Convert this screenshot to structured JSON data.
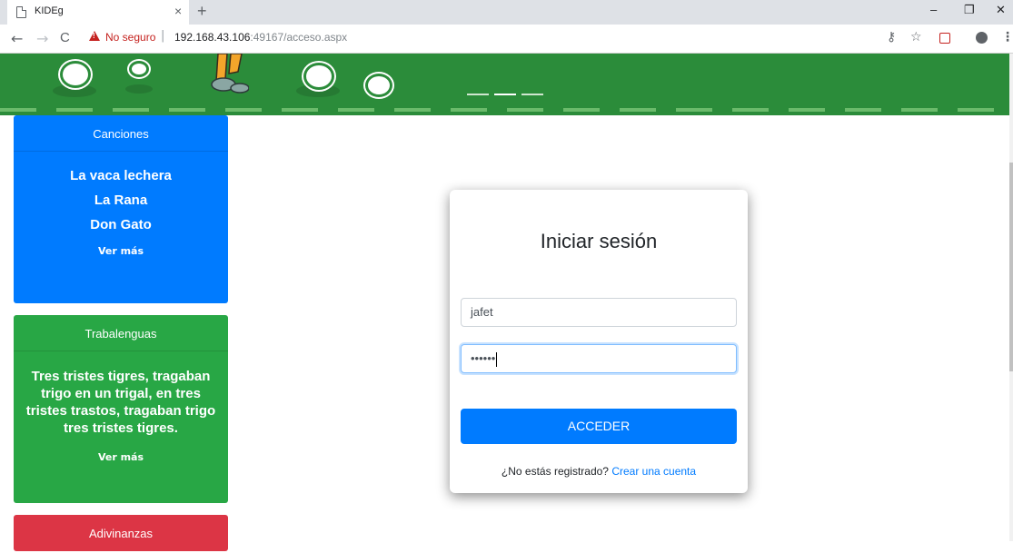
{
  "browser": {
    "tab_title": "KIDEg",
    "tab_close": "×",
    "new_tab": "+",
    "window_controls": {
      "minimize": "–",
      "restore": "❐",
      "close": "✕"
    },
    "nav": {
      "back": "←",
      "forward": "→",
      "reload": "C"
    },
    "url": {
      "security_label": "No seguro",
      "host": "192.168.43.106",
      "path": ":49167/acceso.aspx"
    },
    "toolbar_icons": [
      "key-icon",
      "star-icon",
      "extension-icon",
      "account-icon",
      "menu-icon"
    ]
  },
  "sidebar": {
    "canciones": {
      "header": "Canciones",
      "items": [
        "La vaca lechera",
        "La Rana",
        "Don Gato"
      ],
      "more": "Ver más",
      "color": "#007bff"
    },
    "trabalenguas": {
      "header": "Trabalenguas",
      "text": "Tres tristes tigres, tragaban trigo en un trigal, en tres tristes trastos, tragaban trigo tres tristes tigres.",
      "more": "Ver más",
      "color": "#28a745"
    },
    "adivinanzas": {
      "header": "Adivinanzas",
      "color": "#dc3545"
    }
  },
  "login": {
    "title": "Iniciar sesión",
    "username_value": "jafet",
    "password_value": "••••••",
    "submit_label": "ACCEDER",
    "register_prompt": "¿No estás registrado?",
    "register_link": "Crear una cuenta"
  },
  "colors": {
    "banner": "#2b8c3a",
    "primary": "#007bff"
  }
}
